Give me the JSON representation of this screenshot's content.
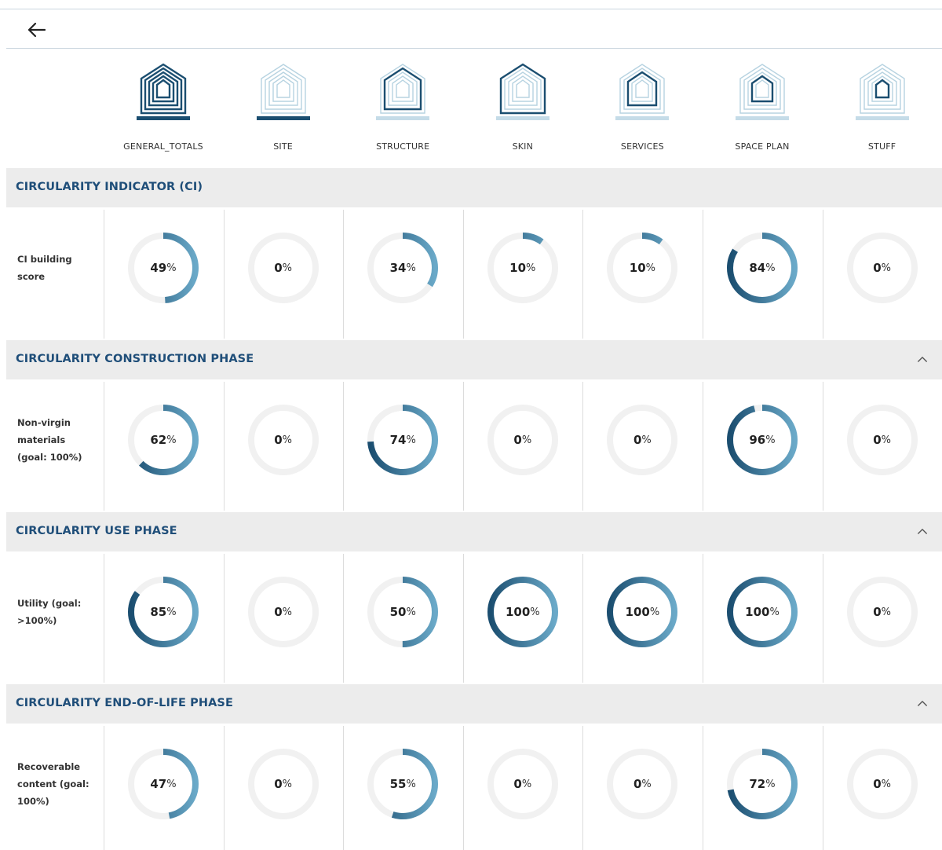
{
  "colors": {
    "dark": "#1b4e70",
    "light": "#6aa9c8",
    "track": "#f1f1f1",
    "section_bg": "#ececec",
    "section_title": "#1f4e79"
  },
  "columns": [
    {
      "label": "GENERAL_TOTALS",
      "icon": "house-layers-general-icon"
    },
    {
      "label": "SITE",
      "icon": "house-layers-site-icon"
    },
    {
      "label": "STRUCTURE",
      "icon": "house-layers-structure-icon"
    },
    {
      "label": "SKIN",
      "icon": "house-layers-skin-icon"
    },
    {
      "label": "SERVICES",
      "icon": "house-layers-services-icon"
    },
    {
      "label": "SPACE PLAN",
      "icon": "house-layers-space-plan-icon"
    },
    {
      "label": "STUFF",
      "icon": "house-layers-stuff-icon"
    }
  ],
  "sections": [
    {
      "title": "CIRCULARITY INDICATOR (CI)",
      "collapsible": false,
      "row": {
        "label": "CI building score",
        "values": [
          49,
          0,
          34,
          10,
          10,
          84,
          0
        ]
      }
    },
    {
      "title": "CIRCULARITY CONSTRUCTION PHASE",
      "collapsible": true,
      "row": {
        "label": "Non-virgin materials (goal: 100%)",
        "values": [
          62,
          0,
          74,
          0,
          0,
          96,
          0
        ]
      }
    },
    {
      "title": "CIRCULARITY USE PHASE",
      "collapsible": true,
      "row": {
        "label": "Utility (goal: >100%)",
        "values": [
          85,
          0,
          50,
          100,
          100,
          100,
          0
        ]
      }
    },
    {
      "title": "CIRCULARITY END-OF-LIFE PHASE",
      "collapsible": true,
      "row": {
        "label": "Recoverable content (goal: 100%)",
        "values": [
          47,
          0,
          55,
          0,
          0,
          72,
          0
        ]
      }
    }
  ],
  "percent_sign": "%"
}
